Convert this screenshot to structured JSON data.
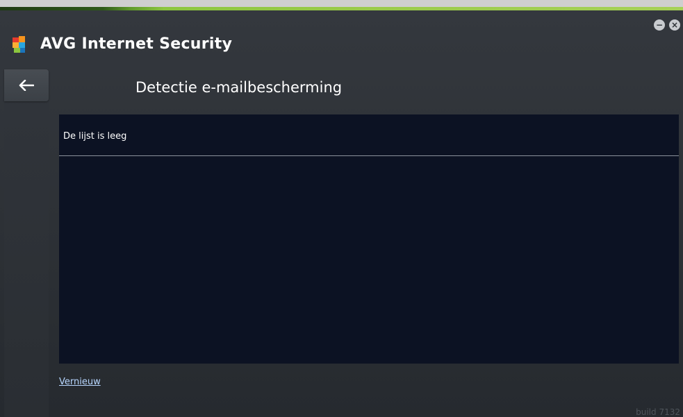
{
  "app": {
    "brand": "AVG",
    "product": "Internet Security",
    "build": "build 7132"
  },
  "window_controls": {
    "minimize_glyph": "−",
    "close_glyph": "×"
  },
  "header": {
    "back_icon": "arrow-left-icon",
    "title": "Detectie e-mailbescherming"
  },
  "list": {
    "empty_message": "De lijst is leeg"
  },
  "footer": {
    "refresh_label": "Vernieuw"
  },
  "colors": {
    "accent_green": "#8cc63f",
    "panel_bg": "#0c1223",
    "link": "#b8d7ff"
  }
}
